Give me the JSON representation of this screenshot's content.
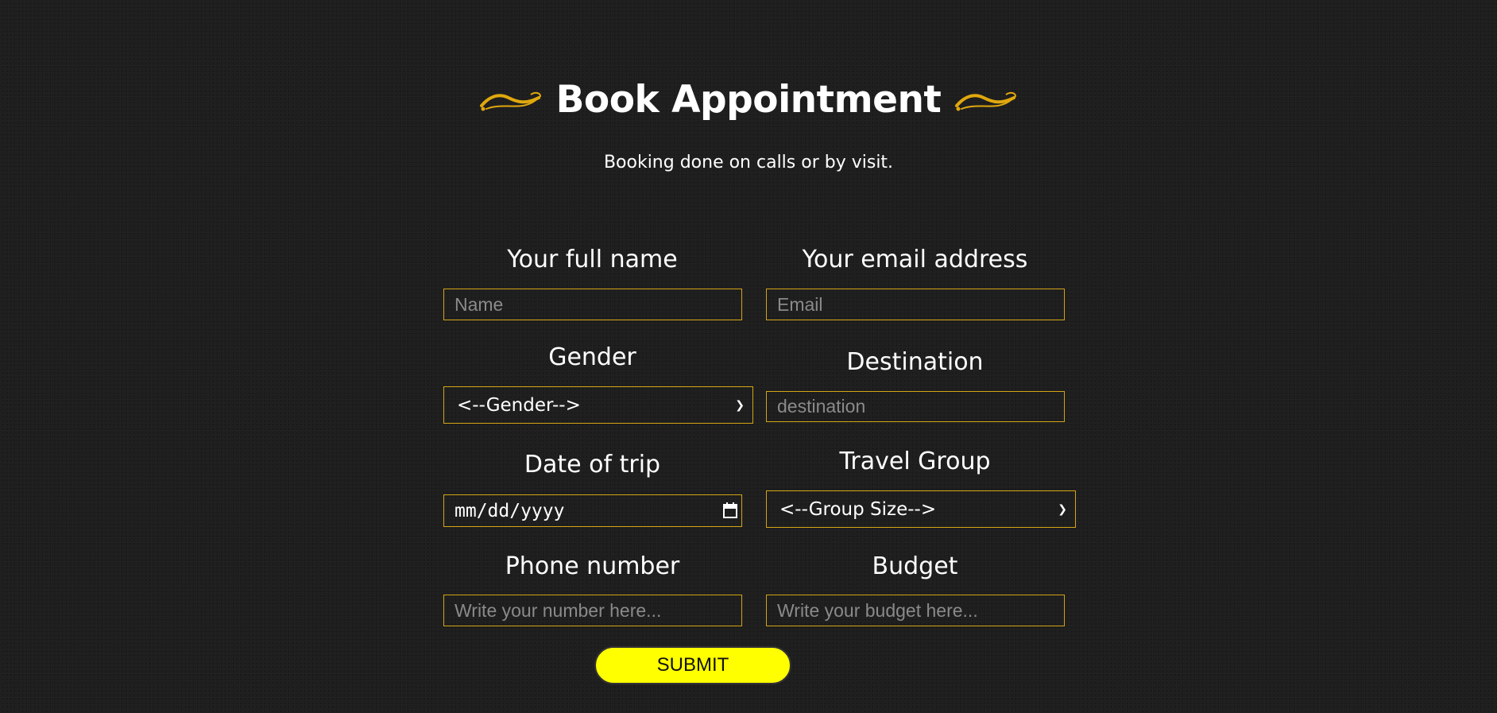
{
  "header": {
    "title": "Book Appointment",
    "subtitle": "Booking done on calls or by visit.",
    "flourish_icon": "swirl-ornament-icon",
    "flourish_color": "#e0a80e"
  },
  "form": {
    "name": {
      "label": "Your full name",
      "placeholder": "Name",
      "value": ""
    },
    "email": {
      "label": "Your email address",
      "placeholder": "Email",
      "value": ""
    },
    "gender": {
      "label": "Gender",
      "selected": "<--Gender-->"
    },
    "destination": {
      "label": "Destination",
      "placeholder": "destination",
      "value": ""
    },
    "date": {
      "label": "Date of trip",
      "value": "mm/dd/yyyy"
    },
    "group": {
      "label": "Travel Group",
      "selected": "<--Group Size-->"
    },
    "phone": {
      "label": "Phone number",
      "placeholder": "Write your number here...",
      "value": ""
    },
    "budget": {
      "label": "Budget",
      "placeholder": "Write your budget here...",
      "value": ""
    },
    "submit_label": "SUBMIT"
  },
  "colors": {
    "border": "#d4a514",
    "submit_bg": "#ffff00",
    "background": "#1e1e1e"
  }
}
